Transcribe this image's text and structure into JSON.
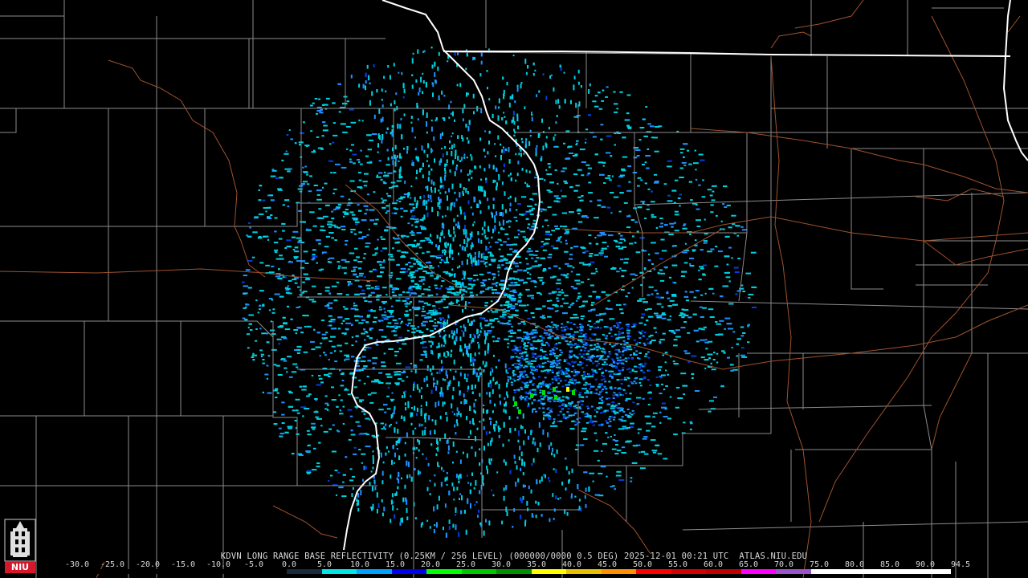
{
  "product_caption": "KDVN LONG RANGE BASE REFLECTIVITY (0.25KM / 256 LEVEL) (000000/0000 0.5 DEG) 2025-12-01 00:21 UTC  ATLAS.NIU.EDU",
  "color_scale": {
    "labels": [
      "-30.0",
      "-25.0",
      "-20.0",
      "-15.0",
      "-10.0",
      "-5.0",
      "0.0",
      "5.0",
      "10.0",
      "15.0",
      "20.0",
      "25.0",
      "30.0",
      "35.0",
      "40.0",
      "45.0",
      "50.0",
      "55.0",
      "60.0",
      "65.0",
      "70.0",
      "75.0",
      "80.0",
      "85.0",
      "90.0",
      "94.5"
    ],
    "colors": [
      "#000000",
      "#000000",
      "#000000",
      "#000000",
      "#000000",
      "#000000",
      "#1a2a3a",
      "#00e5e5",
      "#00a0ff",
      "#0000f0",
      "#00ff00",
      "#00c800",
      "#009000",
      "#ffff00",
      "#e7c000",
      "#ff9000",
      "#ff0000",
      "#d60000",
      "#c00000",
      "#ff00ff",
      "#9955c9",
      "#ffffff",
      "#ffffff",
      "#ffffff",
      "#ffffff"
    ]
  },
  "logo": {
    "text": "NIU",
    "color": "#d4182b"
  },
  "map_colors": {
    "background": "#000000",
    "county_lines": "#8c8c8c",
    "state_lines": "#ffffff",
    "highways": "#a0522d",
    "echo_light": "#00d0e0",
    "echo_mid": "#2090ff",
    "echo_strong": "#0040e0",
    "echo_heavy": "#00e000"
  }
}
